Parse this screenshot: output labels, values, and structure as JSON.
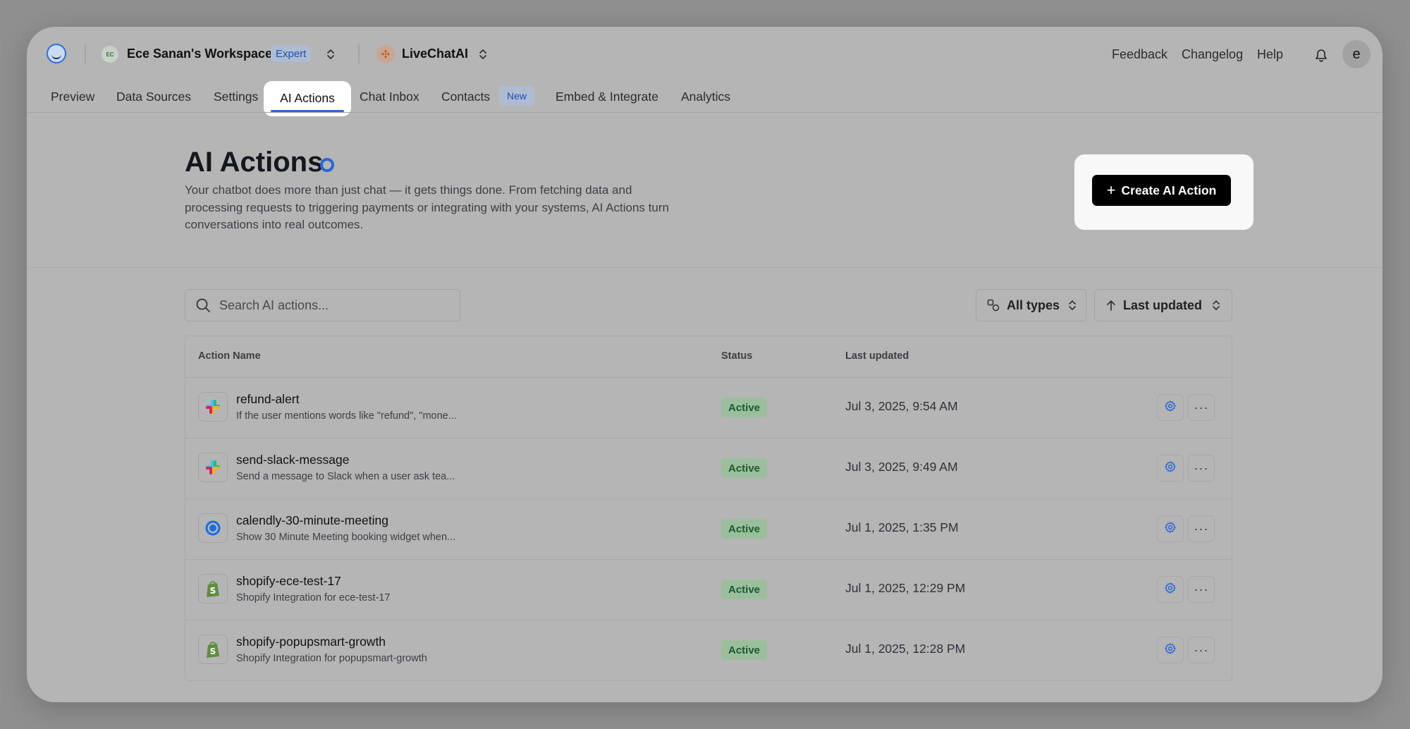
{
  "topbar": {
    "workspace_avatar": "EC",
    "workspace_name": "Ece Sanan's Workspace",
    "workspace_plan": "Expert",
    "chatbot_name": "LiveChatAI",
    "links": [
      "Feedback",
      "Changelog",
      "Help"
    ],
    "user_initial": "e"
  },
  "tabs": [
    {
      "label": "Preview"
    },
    {
      "label": "Data Sources"
    },
    {
      "label": "Settings"
    },
    {
      "label": "AI Actions",
      "active": true
    },
    {
      "label": "Chat Inbox"
    },
    {
      "label": "Contacts",
      "badge": "New"
    },
    {
      "label": "Embed & Integrate"
    },
    {
      "label": "Analytics"
    }
  ],
  "page": {
    "title": "AI Actions",
    "description": "Your chatbot does more than just chat — it gets things done. From fetching data and processing requests to triggering payments or integrating with your systems, AI Actions turn conversations into real outcomes.",
    "create_button": "Create AI Action"
  },
  "toolbar": {
    "search_placeholder": "Search AI actions...",
    "type_filter": "All types",
    "sort": "Last updated"
  },
  "table": {
    "headers": {
      "name": "Action Name",
      "status": "Status",
      "updated": "Last updated"
    },
    "rows": [
      {
        "icon": "slack-icon",
        "name": "refund-alert",
        "desc": "If the user mentions words like \"refund\", \"mone...",
        "status": "Active",
        "updated": "Jul 3, 2025, 9:54 AM"
      },
      {
        "icon": "slack-icon",
        "name": "send-slack-message",
        "desc": "Send a message to Slack when a user ask tea...",
        "status": "Active",
        "updated": "Jul 3, 2025, 9:49 AM"
      },
      {
        "icon": "calendly-icon",
        "name": "calendly-30-minute-meeting",
        "desc": "Show 30 Minute Meeting booking widget when...",
        "status": "Active",
        "updated": "Jul 1, 2025, 1:35 PM"
      },
      {
        "icon": "shopify-icon",
        "name": "shopify-ece-test-17",
        "desc": "Shopify Integration for ece-test-17",
        "status": "Active",
        "updated": "Jul 1, 2025, 12:29 PM"
      },
      {
        "icon": "shopify-icon",
        "name": "shopify-popupsmart-growth",
        "desc": "Shopify Integration for popupsmart-growth",
        "status": "Active",
        "updated": "Jul 1, 2025, 12:28 PM"
      }
    ]
  },
  "colors": {
    "accent": "#2a66d8",
    "primary_button": "#000000",
    "status_active_bg": "#9bbf9d",
    "status_active_text": "#1d5a2a"
  }
}
